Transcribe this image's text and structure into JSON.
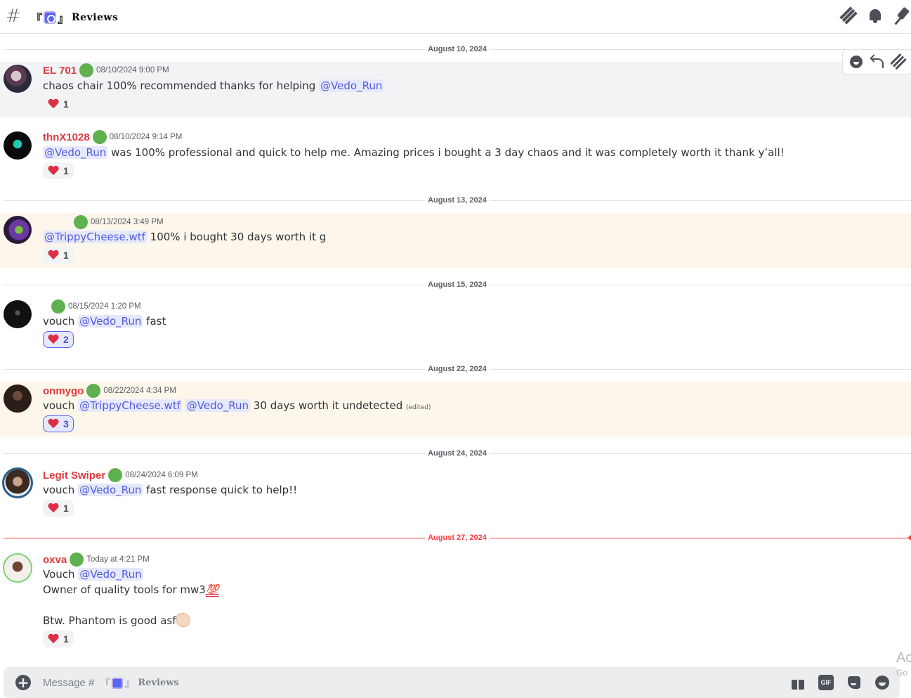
{
  "header": {
    "hash": "#",
    "bracket_open": "『",
    "bracket_close": "』",
    "channel_name": "Reviews"
  },
  "toolbar": {
    "icons": [
      "add-reaction-icon",
      "reply-icon",
      "threads-icon"
    ]
  },
  "dates": {
    "d1": "August 10, 2024",
    "d2": "August 13, 2024",
    "d3": "August 15, 2024",
    "d4": "August 22, 2024",
    "d5": "August 24, 2024",
    "d6": "August 27, 2024"
  },
  "messages": [
    {
      "username": "EL 701",
      "timestamp": "08/10/2024 9:00 PM",
      "text_before": "chaos chair 100% recommended thanks for helping ",
      "mention": "@Vedo_Run",
      "reaction_count": "1"
    },
    {
      "username": "thnX1028",
      "timestamp": "08/10/2024 9:14 PM",
      "mention": "@Vedo_Run",
      "text_after": " was 100% professional and quick to help me. Amazing prices i bought a 3 day chaos and it was completely worth it thank y’all!",
      "reaction_count": "1"
    },
    {
      "username": "",
      "timestamp": "08/13/2024 3:49 PM",
      "mention": "@TrippyCheese.wtf",
      "text_after": "  100% i bought 30 days worth it g",
      "reaction_count": "1"
    },
    {
      "username": "",
      "timestamp": "08/15/2024 1:20 PM",
      "text_before": "vouch ",
      "mention": "@Vedo_Run",
      "text_after": " fast",
      "reaction_count": "2"
    },
    {
      "username": "onmygo",
      "timestamp": "08/22/2024 4:34 PM",
      "text_before": "vouch ",
      "mention": "@TrippyCheese.wtf",
      "mention2": "@Vedo_Run",
      "text_after": "  30 days worth it undetected ",
      "edited": "(edited)",
      "reaction_count": "3"
    },
    {
      "username": "Legit Swiper",
      "timestamp": "08/24/2024 6:09 PM",
      "text_before": "vouch ",
      "mention": "@Vedo_Run",
      "text_after": " fast response quick to help!!",
      "reaction_count": "1"
    },
    {
      "username": "oxva",
      "timestamp": "Today at 4:21 PM",
      "line1_before": "Vouch ",
      "mention": "@Vedo_Run",
      "line2": "Owner of quality tools for mw3",
      "line3": "Btw. Phantom is good asf",
      "reaction_count": "1"
    }
  ],
  "composer": {
    "placeholder_prefix": "Message #",
    "channel_name": "Reviews",
    "plus": "+",
    "gif": "GIF"
  },
  "watermark": {
    "line1": "Ac",
    "line2": "Go"
  },
  "colors": {
    "username": "#e0393e",
    "mention_bg": "#e6e8fd",
    "mention_text": "#505cdc",
    "new_divider": "#f23f43",
    "badge": "#5fb04e"
  }
}
